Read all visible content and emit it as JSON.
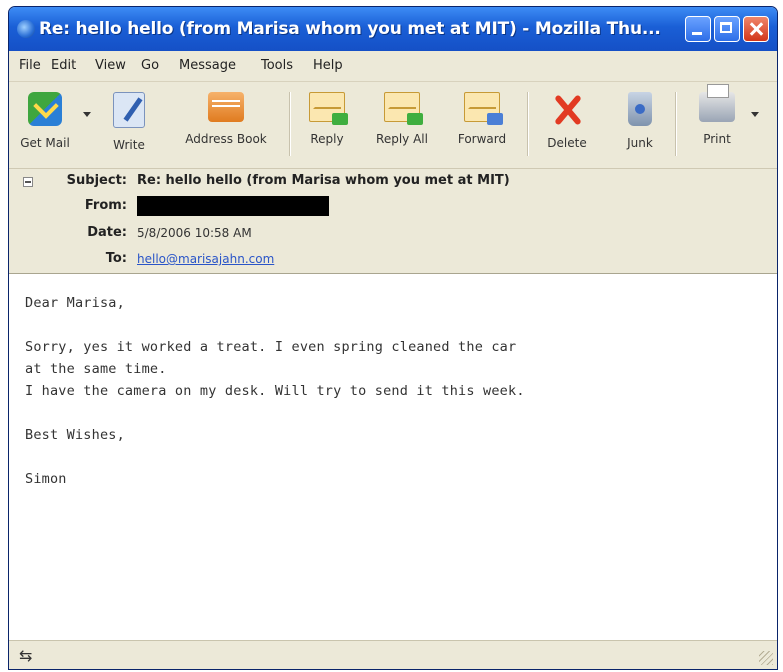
{
  "window": {
    "title": "Re: hello hello (from Marisa whom you met at MIT) - Mozilla Thu..."
  },
  "menu": [
    "File",
    "Edit",
    "View",
    "Go",
    "Message",
    "Tools",
    "Help"
  ],
  "toolbar": {
    "get_mail": "Get Mail",
    "write": "Write",
    "address_book": "Address Book",
    "reply": "Reply",
    "reply_all": "Reply All",
    "forward": "Forward",
    "delete": "Delete",
    "junk": "Junk",
    "print": "Print"
  },
  "header": {
    "subject_label": "Subject:",
    "subject": "Re: hello hello (from Marisa whom you met at MIT)",
    "from_label": "From:",
    "date_label": "Date:",
    "date": "5/8/2006 10:58 AM",
    "to_label": "To:",
    "to": "hello@marisajahn.com"
  },
  "message": {
    "body": "Dear Marisa,\n\nSorry, yes it worked a treat. I even spring cleaned the car\nat the same time.\nI have the camera on my desk. Will try to send it this week.\n\nBest Wishes,\n\nSimon"
  },
  "colors": {
    "titlebar": "#1a5fd6",
    "link": "#2a55c8",
    "chrome": "#ece9d8"
  }
}
